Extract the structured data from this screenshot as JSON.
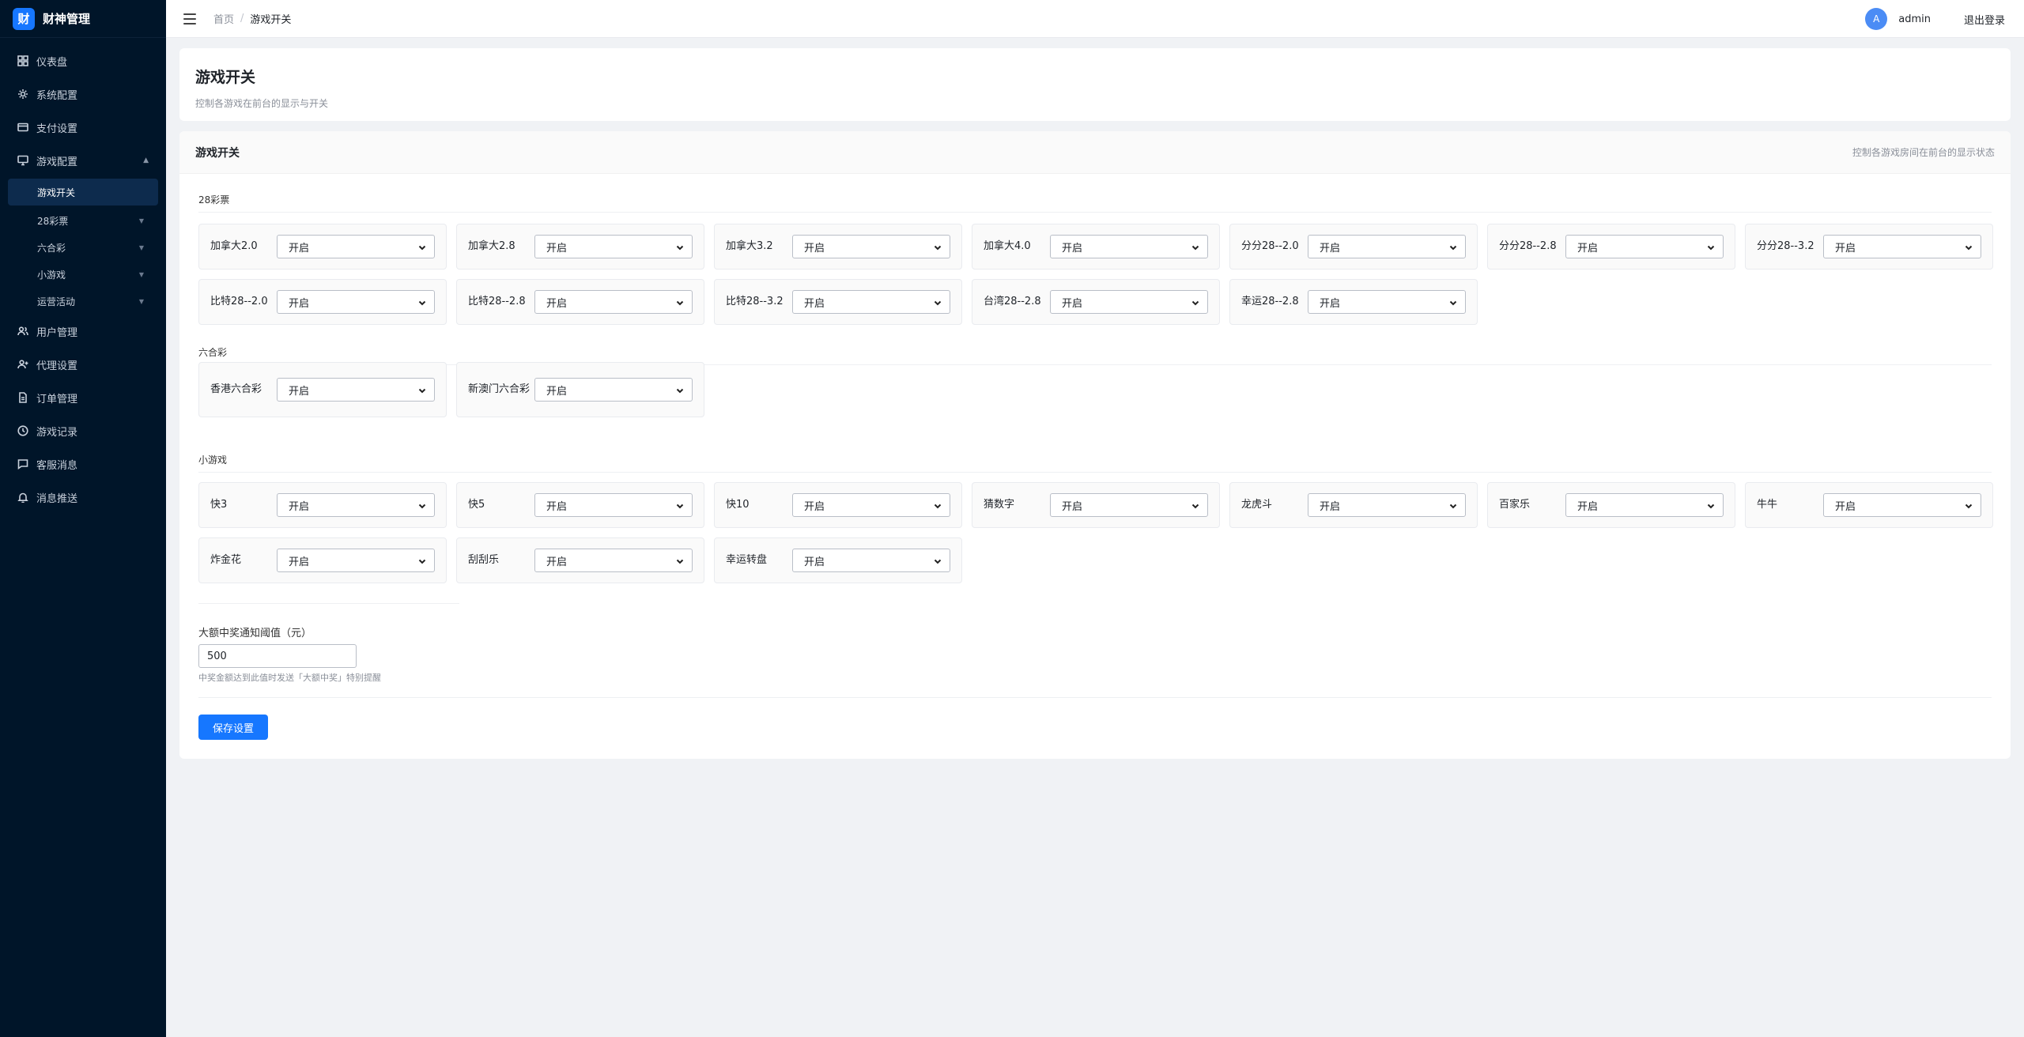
{
  "brand": {
    "logo_char": "财",
    "title": "财神管理"
  },
  "sidebar": {
    "items": [
      {
        "label": "仪表盘",
        "icon": "dashboard-icon"
      },
      {
        "label": "系统配置",
        "icon": "gear-icon"
      },
      {
        "label": "支付设置",
        "icon": "credit-card-icon"
      },
      {
        "label": "游戏配置",
        "icon": "monitor-icon"
      },
      {
        "label": "用户管理",
        "icon": "users-icon"
      },
      {
        "label": "代理设置",
        "icon": "user-add-icon"
      },
      {
        "label": "订单管理",
        "icon": "document-icon"
      },
      {
        "label": "游戏记录",
        "icon": "clock-icon"
      },
      {
        "label": "客服消息",
        "icon": "chat-icon"
      },
      {
        "label": "消息推送",
        "icon": "bell-icon"
      }
    ],
    "sub_items": [
      {
        "label": "游戏开关"
      },
      {
        "label": "28彩票"
      },
      {
        "label": "六合彩"
      },
      {
        "label": "小游戏"
      },
      {
        "label": "运营活动"
      }
    ]
  },
  "header": {
    "breadcrumb_home": "首页",
    "breadcrumb_sep": "/",
    "breadcrumb_current": "游戏开关",
    "avatar_letter": "A",
    "user_name": "admin",
    "logout": "退出登录"
  },
  "page": {
    "title": "游戏开关",
    "subtitle": "控制各游戏在前台的显示与开关"
  },
  "card": {
    "title": "游戏开关",
    "hint": "控制各游戏房间在前台的显示状态",
    "option_value": "开启",
    "sections": [
      {
        "label": "28彩票",
        "games": [
          "加拿大2.0",
          "加拿大2.8",
          "加拿大3.2",
          "加拿大4.0",
          "分分28--2.0",
          "分分28--2.8",
          "分分28--3.2",
          "比特28--2.0",
          "比特28--2.8",
          "比特28--3.2",
          "台湾28--2.8",
          "幸运28--2.8"
        ]
      },
      {
        "label": "六合彩",
        "games": [
          "香港六合彩",
          "新澳门六合彩"
        ]
      },
      {
        "label": "小游戏",
        "games": [
          "快3",
          "快5",
          "快10",
          "猜数字",
          "龙虎斗",
          "百家乐",
          "牛牛",
          "炸金花",
          "刮刮乐",
          "幸运转盘"
        ]
      }
    ],
    "threshold_label": "大额中奖通知阈值（元）",
    "threshold_value": "500",
    "threshold_hint": "中奖金额达到此值时发送「大额中奖」特别提醒",
    "save_label": "保存设置"
  },
  "colors": {
    "sidebar_bg": "#001529",
    "accent": "#1677ff",
    "page_bg": "#f0f2f5"
  }
}
